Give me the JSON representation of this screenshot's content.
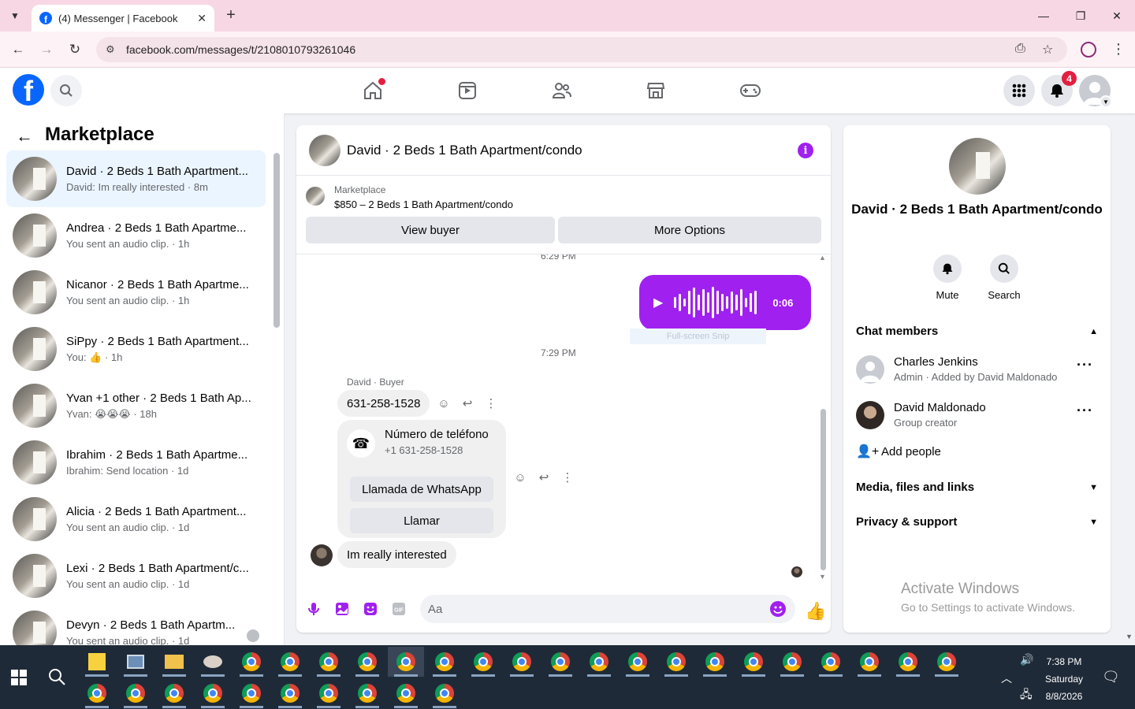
{
  "browser": {
    "tab_title": "(4) Messenger | Facebook",
    "url": "facebook.com/messages/t/2108010793261046"
  },
  "fb_header": {
    "notification_count": "4"
  },
  "left_panel": {
    "title": "Marketplace",
    "conversations": [
      {
        "name": "David · 2 Beds 1 Bath Apartment...",
        "preview": "David: Im really interested · 8m"
      },
      {
        "name": "Andrea · 2 Beds 1 Bath Apartme...",
        "preview": "You sent an audio clip. · 1h"
      },
      {
        "name": "Nicanor · 2 Beds 1 Bath Apartme...",
        "preview": "You sent an audio clip. · 1h"
      },
      {
        "name": "SiPpy · 2 Beds 1 Bath Apartment...",
        "preview": "You: 👍 · 1h"
      },
      {
        "name": "Yvan +1 other · 2 Beds 1 Bath Ap...",
        "preview": "Yvan: 😭😭😭 · 18h"
      },
      {
        "name": "Ibrahim · 2 Beds 1 Bath Apartme...",
        "preview": "Ibrahim: Send location · 1d"
      },
      {
        "name": "Alicia · 2 Beds 1 Bath Apartment...",
        "preview": "You sent an audio clip. · 1d"
      },
      {
        "name": "Lexi · 2 Beds 1 Bath Apartment/c...",
        "preview": "You sent an audio clip. · 1d"
      },
      {
        "name": "Devyn · 2 Beds 1 Bath Apartm...",
        "preview": "You sent an audio clip. · 1d"
      }
    ]
  },
  "chat": {
    "title": "David · 2 Beds 1 Bath Apartment/condo",
    "marketplace_label": "Marketplace",
    "listing": "$850 – 2 Beds 1 Bath Apartment/condo",
    "view_buyer": "View buyer",
    "more_options": "More Options",
    "time_1": "6:29 PM",
    "audio_duration": "0:06",
    "snip_label": "Full-screen Snip",
    "time_2": "7:29 PM",
    "sender": "David · Buyer",
    "phone_message": "631-258-1528",
    "phone_card_title": "Número de teléfono",
    "phone_card_number": "+1 631-258-1528",
    "whatsapp_button": "Llamada de WhatsApp",
    "call_button": "Llamar",
    "last_message": "Im really interested",
    "composer_placeholder": "Aa"
  },
  "right_panel": {
    "name": "David · 2 Beds 1 Bath Apartment/condo",
    "mute_label": "Mute",
    "search_label": "Search",
    "chat_members_label": "Chat members",
    "members": [
      {
        "name": "Charles Jenkins",
        "sub": "Admin · Added by David Maldonado"
      },
      {
        "name": "David Maldonado",
        "sub": "Group creator"
      }
    ],
    "add_people": "Add people",
    "media_label": "Media, files and links",
    "privacy_label": "Privacy & support"
  },
  "watermark": {
    "line1": "Activate Windows",
    "line2": "Go to Settings to activate Windows."
  },
  "taskbar": {
    "time": "7:38 PM",
    "day": "Saturday",
    "date": "8/8/2026"
  },
  "colors": {
    "accent": "#a020f0",
    "fb_blue": "#0866ff",
    "tab_bar": "#f8d7e4"
  }
}
